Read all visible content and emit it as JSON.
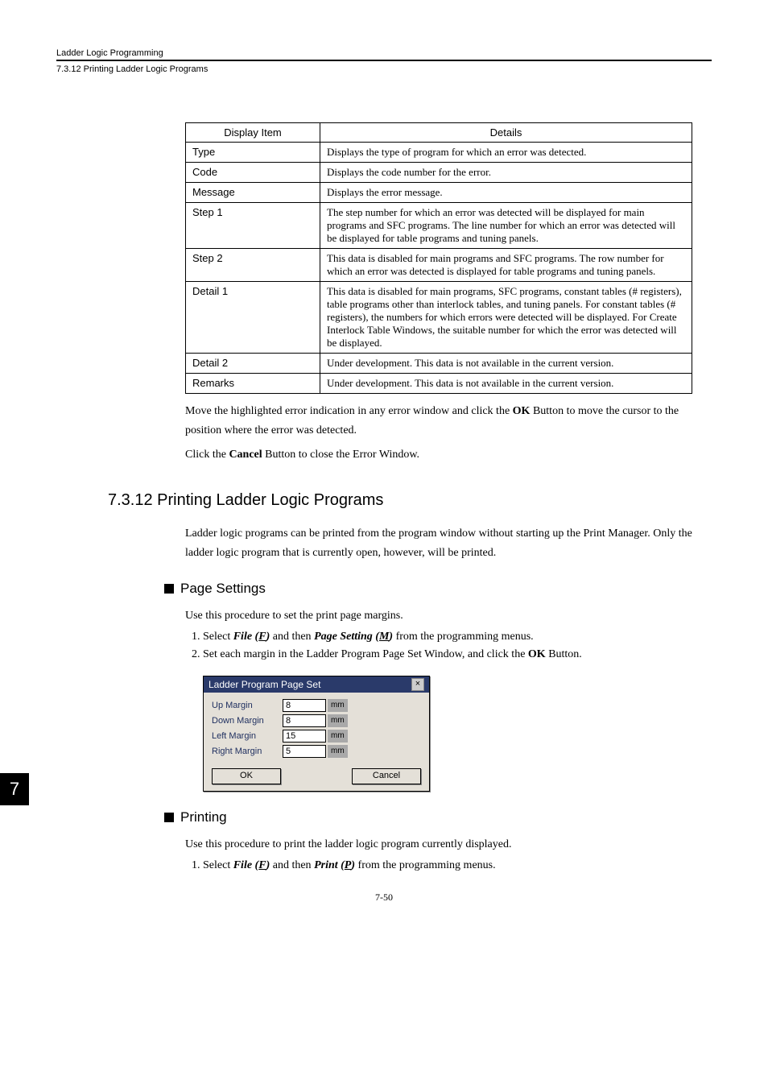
{
  "header": {
    "title": "Ladder Logic Programming",
    "subtitle": "7.3.12  Printing Ladder Logic Programs"
  },
  "table": {
    "heads": {
      "item": "Display Item",
      "details": "Details"
    },
    "rows": [
      {
        "item": "Type",
        "details": "Displays the type of program for which an error was detected."
      },
      {
        "item": "Code",
        "details": "Displays the code number for the error."
      },
      {
        "item": "Message",
        "details": "Displays the error message."
      },
      {
        "item": "Step 1",
        "details": "The step number for which an error was detected will be displayed for main programs and SFC programs. The line number for which an error was detected will be displayed for table programs and tuning panels."
      },
      {
        "item": "Step 2",
        "details": "This data is disabled for main programs and SFC programs. The row number for which an error was detected is displayed for table programs and tuning panels."
      },
      {
        "item": "Detail 1",
        "details": "This data is disabled for main programs, SFC programs, constant tables (# registers), table programs other than interlock tables, and tuning panels. For constant tables (# registers), the numbers for which errors were detected will be displayed. For Create Interlock Table Windows, the suitable number for which the error was detected will be displayed."
      },
      {
        "item": "Detail 2",
        "details": "Under development. This data is not available in the current version."
      },
      {
        "item": "Remarks",
        "details": "Under development. This data is not available in the current version."
      }
    ]
  },
  "para1a": "Move the highlighted error indication in any error window and click the ",
  "para1b": "OK",
  "para1c": " Button to move the cursor to the position where the error was detected.",
  "para2a": "Click the ",
  "para2b": "Cancel",
  "para2c": " Button to close the Error Window.",
  "section": {
    "title": "7.3.12  Printing Ladder Logic Programs",
    "intro": "Ladder logic programs can be printed from the program window without starting up the Print Manager. Only the ladder logic program that is currently open, however, will be printed."
  },
  "page_settings": {
    "heading": "Page Settings",
    "intro": "Use this procedure to set the print page margins.",
    "steps": {
      "s1": {
        "a": "Select ",
        "b": "File (",
        "u": "F",
        "c": ")",
        "d": " and then ",
        "e": "Page Setting (",
        "u2": "M",
        "f": ")",
        "g": " from the programming menus."
      },
      "s2": {
        "a": "Set each margin in the Ladder Program Page Set Window, and click the ",
        "b": "OK",
        "c": " Button."
      }
    }
  },
  "dialog": {
    "title": "Ladder Program Page Set",
    "rows": [
      {
        "label": "Up Margin",
        "value": "8",
        "unit": "mm"
      },
      {
        "label": "Down Margin",
        "value": "8",
        "unit": "mm"
      },
      {
        "label": "Left Margin",
        "value": "15",
        "unit": "mm"
      },
      {
        "label": "Right Margin",
        "value": "5",
        "unit": "mm"
      }
    ],
    "ok": "OK",
    "cancel": "Cancel"
  },
  "printing": {
    "heading": "Printing",
    "intro": "Use this procedure to print the ladder logic program currently displayed.",
    "step1": {
      "a": "Select ",
      "b": "File (",
      "u": "F",
      "c": ")",
      "d": " and then ",
      "e": "Print (",
      "u2": "P",
      "f": ")",
      "g": " from the programming menus."
    }
  },
  "chapter_tab": "7",
  "footer": "7-50"
}
